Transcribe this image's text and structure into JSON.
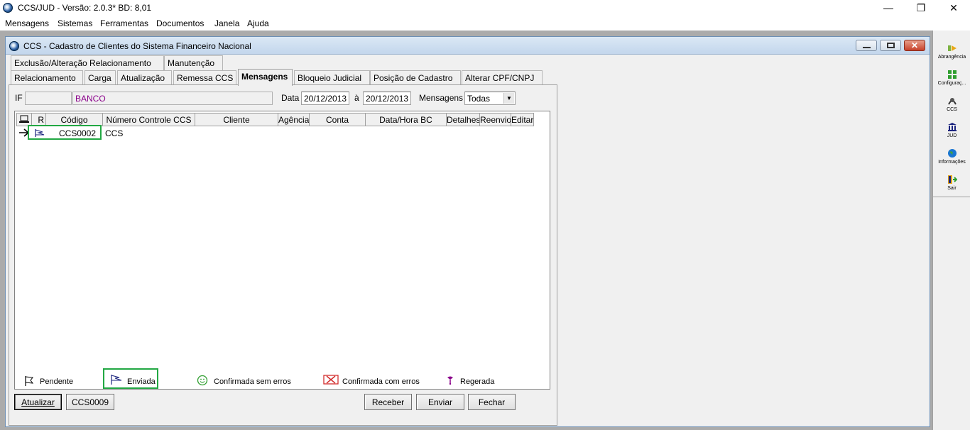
{
  "window": {
    "title": "CCS/JUD - Versão: 2.0.3* BD: 8,01"
  },
  "menubar": [
    "Mensagens",
    "Sistemas",
    "Ferramentas",
    "Documentos",
    "Janela",
    "Ajuda"
  ],
  "child": {
    "title": "CCS - Cadastro de Clientes do Sistema Financeiro Nacional"
  },
  "tabs": {
    "row1": [
      "Exclusão/Alteração Relacionamento",
      "Manutenção"
    ],
    "row2": [
      "Relacionamento",
      "Carga",
      "Atualização",
      "Remessa CCS",
      "Mensagens",
      "Bloqueio Judicial",
      "Posição de Cadastro",
      "Alterar CPF/CNPJ"
    ],
    "active": "Mensagens"
  },
  "filters": {
    "if_label": "IF",
    "if_code": "",
    "if_name": "BANCO",
    "data_label": "Data",
    "date_from": "20/12/2013",
    "a_label": "à",
    "date_to": "20/12/2013",
    "mensagens_label": "Mensagens",
    "mensagens_value": "Todas"
  },
  "grid": {
    "columns": [
      "",
      "R",
      "Código",
      "Número Controle CCS",
      "Cliente",
      "Agência",
      "Conta",
      "Data/Hora BC",
      "Detalhes",
      "Reenvio",
      "Editar"
    ],
    "rows": [
      {
        "status": "Enviada",
        "codigo": "CCS0002",
        "numero_controle": "CCS",
        "cliente": "",
        "agencia": "",
        "conta": "",
        "data_hora": ""
      }
    ]
  },
  "legend": [
    "Pendente",
    "Enviada",
    "Confirmada sem erros",
    "Confirmada com erros",
    "Regerada"
  ],
  "buttons": {
    "atualizar": "Atualizar",
    "ccs0009": "CCS0009",
    "receber": "Receber",
    "enviar": "Enviar",
    "fechar": "Fechar"
  },
  "sidebar": [
    "Abrangência",
    "Configuraç...",
    "CCS",
    "JUD",
    "Informações",
    "Sair"
  ],
  "colors": {
    "highlight": "#22a843",
    "flag_blue": "#1a237e",
    "error_red": "#d32f2f",
    "ok_green": "#2e9e2e",
    "purple_text": "#8b008b"
  }
}
